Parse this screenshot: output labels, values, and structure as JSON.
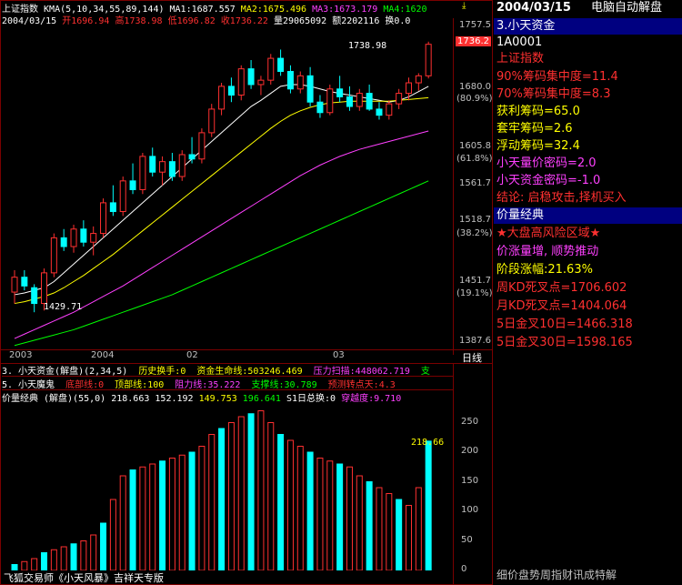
{
  "header": {
    "index_name": "上证指数",
    "ma_text": "KMA(5,10,34,55,89,144)",
    "ma1": "MA1:1687.557",
    "ma2": "MA2:1675.496",
    "ma3": "MA3:1673.179",
    "ma4": "MA4:1620",
    "date": "2004/03/15",
    "open": "开1696.94",
    "high": "高1738.98",
    "low": "低1696.82",
    "close": "收1736.22",
    "volume": "量29065092",
    "amount": "额2202116",
    "turnover": "换0.0"
  },
  "price_axis": {
    "ticks": [
      "1757.5",
      "1680.0",
      "1605.8",
      "1561.7",
      "1518.7",
      "1451.7",
      "1387.6"
    ],
    "pcts": [
      "(80.9%)",
      "(61.8%)",
      "(38.2%)",
      "(19.1%)"
    ],
    "current_tag": "1736.2"
  },
  "annotations": {
    "high_label": "1738.98",
    "low_label": "1429.71"
  },
  "time_axis": {
    "labels": [
      "2003",
      "2004",
      "02",
      "03"
    ],
    "period_button": "日线"
  },
  "chart_data": [
    {
      "type": "candlestick",
      "title": "上证指数",
      "ylim": [
        1387.6,
        1757.5
      ],
      "x_labels": [
        "2003",
        "2004",
        "02",
        "03"
      ],
      "candles": [
        [
          1453,
          1478,
          1440,
          1470
        ],
        [
          1470,
          1478,
          1455,
          1460
        ],
        [
          1458,
          1462,
          1430,
          1440
        ],
        [
          1440,
          1480,
          1432,
          1475
        ],
        [
          1475,
          1520,
          1470,
          1515
        ],
        [
          1515,
          1525,
          1500,
          1505
        ],
        [
          1505,
          1530,
          1498,
          1525
        ],
        [
          1525,
          1535,
          1505,
          1510
        ],
        [
          1510,
          1528,
          1495,
          1520
        ],
        [
          1520,
          1560,
          1515,
          1555
        ],
        [
          1555,
          1575,
          1540,
          1545
        ],
        [
          1545,
          1585,
          1540,
          1580
        ],
        [
          1580,
          1600,
          1565,
          1570
        ],
        [
          1570,
          1612,
          1565,
          1608
        ],
        [
          1608,
          1618,
          1585,
          1590
        ],
        [
          1590,
          1608,
          1575,
          1602
        ],
        [
          1602,
          1612,
          1580,
          1585
        ],
        [
          1585,
          1615,
          1580,
          1610
        ],
        [
          1610,
          1630,
          1600,
          1605
        ],
        [
          1605,
          1640,
          1600,
          1635
        ],
        [
          1635,
          1668,
          1630,
          1662
        ],
        [
          1662,
          1692,
          1655,
          1688
        ],
        [
          1688,
          1698,
          1670,
          1678
        ],
        [
          1678,
          1712,
          1672,
          1708
        ],
        [
          1708,
          1718,
          1685,
          1690
        ],
        [
          1690,
          1700,
          1678,
          1695
        ],
        [
          1695,
          1725,
          1690,
          1720
        ],
        [
          1720,
          1730,
          1700,
          1705
        ],
        [
          1705,
          1712,
          1680,
          1685
        ],
        [
          1685,
          1705,
          1680,
          1700
        ],
        [
          1700,
          1710,
          1665,
          1670
        ],
        [
          1670,
          1678,
          1652,
          1658
        ],
        [
          1658,
          1690,
          1655,
          1685
        ],
        [
          1685,
          1700,
          1670,
          1676
        ],
        [
          1676,
          1688,
          1660,
          1665
        ],
        [
          1665,
          1685,
          1660,
          1680
        ],
        [
          1680,
          1690,
          1660,
          1662
        ],
        [
          1662,
          1670,
          1650,
          1655
        ],
        [
          1655,
          1672,
          1650,
          1668
        ],
        [
          1668,
          1685,
          1662,
          1680
        ],
        [
          1680,
          1698,
          1672,
          1692
        ],
        [
          1692,
          1703,
          1683,
          1700
        ],
        [
          1700,
          1739,
          1697,
          1736
        ]
      ],
      "series": [
        {
          "name": "MA1",
          "values": [
            1450,
            1452,
            1455,
            1458,
            1465,
            1475,
            1485,
            1495,
            1505,
            1515,
            1525,
            1535,
            1545,
            1555,
            1565,
            1575,
            1585,
            1595,
            1605,
            1615,
            1625,
            1635,
            1645,
            1655,
            1665,
            1672,
            1680,
            1688,
            1690,
            1690,
            1688,
            1685,
            1682,
            1680,
            1678,
            1676,
            1674,
            1672,
            1670,
            1672,
            1676,
            1682,
            1688
          ]
        },
        {
          "name": "MA2",
          "values": [
            1440,
            1442,
            1445,
            1448,
            1452,
            1458,
            1465,
            1472,
            1480,
            1488,
            1496,
            1505,
            1514,
            1523,
            1532,
            1541,
            1550,
            1559,
            1568,
            1577,
            1586,
            1595,
            1604,
            1613,
            1622,
            1631,
            1640,
            1648,
            1655,
            1660,
            1664,
            1667,
            1669,
            1670,
            1671,
            1671,
            1671,
            1671,
            1671,
            1672,
            1673,
            1674,
            1675
          ]
        },
        {
          "name": "MA3",
          "values": [
            1400,
            1405,
            1410,
            1415,
            1420,
            1425,
            1430,
            1436,
            1442,
            1448,
            1454,
            1460,
            1467,
            1474,
            1481,
            1488,
            1495,
            1502,
            1509,
            1516,
            1523,
            1530,
            1537,
            1544,
            1551,
            1558,
            1565,
            1572,
            1579,
            1586,
            1592,
            1598,
            1603,
            1608,
            1612,
            1616,
            1619,
            1622,
            1625,
            1628,
            1631,
            1634,
            1637
          ]
        },
        {
          "name": "MA4",
          "values": [
            1392,
            1395,
            1398,
            1401,
            1404,
            1407,
            1410,
            1414,
            1418,
            1422,
            1426,
            1430,
            1434,
            1438,
            1442,
            1446,
            1450,
            1455,
            1460,
            1465,
            1470,
            1475,
            1480,
            1485,
            1490,
            1495,
            1500,
            1505,
            1510,
            1515,
            1520,
            1525,
            1530,
            1535,
            1540,
            1545,
            1550,
            1555,
            1560,
            1565,
            1570,
            1575,
            1580
          ]
        }
      ]
    },
    {
      "type": "bar",
      "title": "价量经典 (解盘)(55,0)",
      "ylim": [
        0,
        280
      ],
      "ticks": [
        250,
        200,
        150,
        100,
        50,
        0
      ],
      "last_value": 218.66,
      "values": [
        10,
        15,
        20,
        30,
        35,
        40,
        45,
        50,
        60,
        80,
        120,
        160,
        170,
        175,
        180,
        185,
        190,
        195,
        200,
        210,
        230,
        240,
        250,
        260,
        265,
        270,
        250,
        230,
        220,
        210,
        200,
        190,
        185,
        180,
        175,
        160,
        150,
        140,
        130,
        120,
        110,
        140,
        218.66
      ]
    }
  ],
  "bottom_rows": {
    "row3": {
      "label": "3. 小天资金(解盘)(2,34,5)",
      "history": "历史换手:0",
      "lifeline": "资金生命线:503246.469",
      "pressure": "压力扫描:448062.719",
      "support": "支"
    },
    "row5": {
      "label": "5. 小天魔鬼",
      "bottom": "底部线:0",
      "top": "顶部线:100",
      "resist": "阻力线:35.222",
      "support": "支撑线:30.789",
      "predict": "预测转点天:4.3"
    },
    "vol_header": {
      "label": "价量经典 (解盘)(55,0)",
      "v1": "218.663",
      "v2": "152.192",
      "v3": "149.753",
      "v4": "196.641",
      "v5": "S1日总换:0",
      "v6": "穿越度:9.710"
    },
    "status_left": "飞狐交易师《小天风暴》吉祥天专版"
  },
  "sidebar": {
    "date": "2004/03/15",
    "title": "电脑自动解盘",
    "section1_header": "3.小天资金",
    "code": "1A0001",
    "name": "上证指数",
    "lines1": [
      {
        "text": "90%筹码集中度=11.4",
        "color": "#ff3030"
      },
      {
        "text": "70%筹码集中度=8.3",
        "color": "#ff3030"
      },
      {
        "text": "获利筹码=65.0",
        "color": "#ffff00"
      },
      {
        "text": "套牢筹码=2.6",
        "color": "#ffff00"
      },
      {
        "text": "浮动筹码=32.4",
        "color": "#ffff00"
      },
      {
        "text": "小天量价密码=2.0",
        "color": "#ff40ff"
      },
      {
        "text": "小天资金密码=-1.0",
        "color": "#ff40ff"
      },
      {
        "text": "结论: 启稳攻击,择机买入",
        "color": "#ff3030"
      }
    ],
    "section2_header": "价量经典",
    "lines2": [
      {
        "text": "★大盘高风险区域★",
        "color": "#ff3030"
      },
      {
        "text": "价涨量增, 顺势推动",
        "color": "#ff40ff"
      },
      {
        "text": "阶段涨幅:21.63%",
        "color": "#ffff00"
      },
      {
        "text": "周KD死叉点=1706.602",
        "color": "#ff3030"
      },
      {
        "text": "月KD死叉点=1404.064",
        "color": "#ff3030"
      },
      {
        "text": "5日金叉10日=1466.318",
        "color": "#ff3030"
      },
      {
        "text": "5日金叉30日=1598.165",
        "color": "#ff3030"
      }
    ],
    "ticker": "细价盘势周指财讯成特解"
  }
}
